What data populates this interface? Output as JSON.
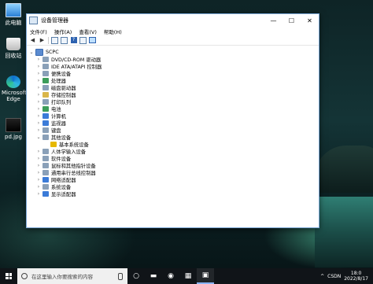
{
  "desktop": {
    "icons": [
      {
        "label": "此电脑"
      },
      {
        "label": "回收站"
      },
      {
        "label": "Microsoft Edge"
      },
      {
        "label": "pd.jpg"
      }
    ]
  },
  "window": {
    "title": "设备管理器",
    "controls": {
      "minimize": "—",
      "maximize": "☐",
      "close": "✕"
    },
    "menu": [
      "文件(F)",
      "操作(A)",
      "查看(V)",
      "帮助(H)"
    ],
    "tree": {
      "root": "SCPC",
      "items": [
        {
          "label": "DVD/CD-ROM 驱动器"
        },
        {
          "label": "IDE ATA/ATAPI 控制器"
        },
        {
          "label": "便携设备"
        },
        {
          "label": "处理器"
        },
        {
          "label": "磁盘驱动器"
        },
        {
          "label": "存储控制器"
        },
        {
          "label": "打印队列"
        },
        {
          "label": "电池"
        },
        {
          "label": "计算机"
        },
        {
          "label": "监视器"
        },
        {
          "label": "键盘"
        },
        {
          "label": "其他设备"
        },
        {
          "label": "基本系统设备"
        },
        {
          "label": "人体学输入设备"
        },
        {
          "label": "软件设备"
        },
        {
          "label": "鼠标和其他指针设备"
        },
        {
          "label": "通用串行总线控制器"
        },
        {
          "label": "网络适配器"
        },
        {
          "label": "系统设备"
        },
        {
          "label": "显示适配器"
        }
      ]
    }
  },
  "taskbar": {
    "search_placeholder": "在这里输入你要搜索的内容",
    "tray_text": "CSDN",
    "time": "18:0",
    "date": "2022/8/17"
  }
}
